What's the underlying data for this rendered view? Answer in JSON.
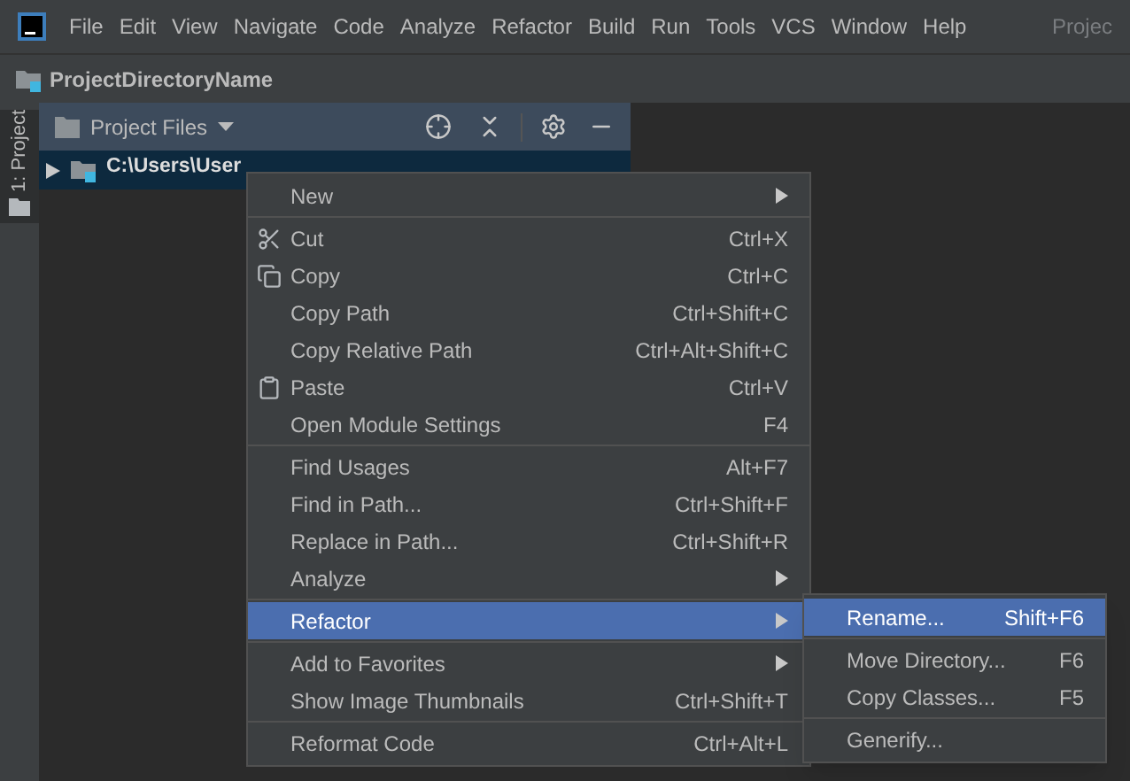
{
  "menu_bar": {
    "items": [
      "File",
      "Edit",
      "View",
      "Navigate",
      "Code",
      "Analyze",
      "Refactor",
      "Build",
      "Run",
      "Tools",
      "VCS",
      "Window",
      "Help"
    ],
    "title": "Projec"
  },
  "breadcrumb": "ProjectDirectoryName",
  "side_tab": "1: Project",
  "project_panel": {
    "view": "Project Files",
    "tree": [
      {
        "label": "C:\\Users\\User",
        "selected": true,
        "expanded": false
      }
    ]
  },
  "context_menu": [
    {
      "kind": "item",
      "label": "New",
      "submenu": true,
      "selected": false
    },
    {
      "kind": "separator"
    },
    {
      "kind": "item",
      "label": "Cut",
      "shortcut": "Ctrl+X",
      "selected": false
    },
    {
      "kind": "item",
      "label": "Copy",
      "shortcut": "Ctrl+C",
      "selected": false
    },
    {
      "kind": "item",
      "label": "Copy Path",
      "shortcut": "Ctrl+Shift+C",
      "selected": false
    },
    {
      "kind": "item",
      "label": "Copy Relative Path",
      "shortcut": "Ctrl+Alt+Shift+C",
      "selected": false
    },
    {
      "kind": "item",
      "label": "Paste",
      "shortcut": "Ctrl+V",
      "selected": false
    },
    {
      "kind": "item",
      "label": "Open Module Settings",
      "shortcut": "F4",
      "selected": false
    },
    {
      "kind": "separator"
    },
    {
      "kind": "item",
      "label": "Find Usages",
      "shortcut": "Alt+F7",
      "selected": false
    },
    {
      "kind": "item",
      "label": "Find in Path...",
      "shortcut": "Ctrl+Shift+F",
      "selected": false
    },
    {
      "kind": "item",
      "label": "Replace in Path...",
      "shortcut": "Ctrl+Shift+R",
      "selected": false
    },
    {
      "kind": "item",
      "label": "Analyze",
      "submenu": true,
      "selected": false
    },
    {
      "kind": "separator"
    },
    {
      "kind": "item",
      "label": "Refactor",
      "submenu": true,
      "selected": true
    },
    {
      "kind": "separator"
    },
    {
      "kind": "item",
      "label": "Add to Favorites",
      "submenu": true,
      "selected": false
    },
    {
      "kind": "item",
      "label": "Show Image Thumbnails",
      "shortcut": "Ctrl+Shift+T",
      "selected": false
    },
    {
      "kind": "separator"
    },
    {
      "kind": "item",
      "label": "Reformat Code",
      "shortcut": "Ctrl+Alt+L",
      "selected": false
    }
  ],
  "submenu": [
    {
      "kind": "item",
      "label": "Rename...",
      "shortcut": "Shift+F6",
      "selected": true
    },
    {
      "kind": "separator"
    },
    {
      "kind": "item",
      "label": "Move Directory...",
      "shortcut": "F6",
      "selected": false
    },
    {
      "kind": "item",
      "label": "Copy Classes...",
      "shortcut": "F5",
      "selected": false
    },
    {
      "kind": "separator"
    },
    {
      "kind": "item",
      "label": "Generify...",
      "selected": false
    }
  ]
}
